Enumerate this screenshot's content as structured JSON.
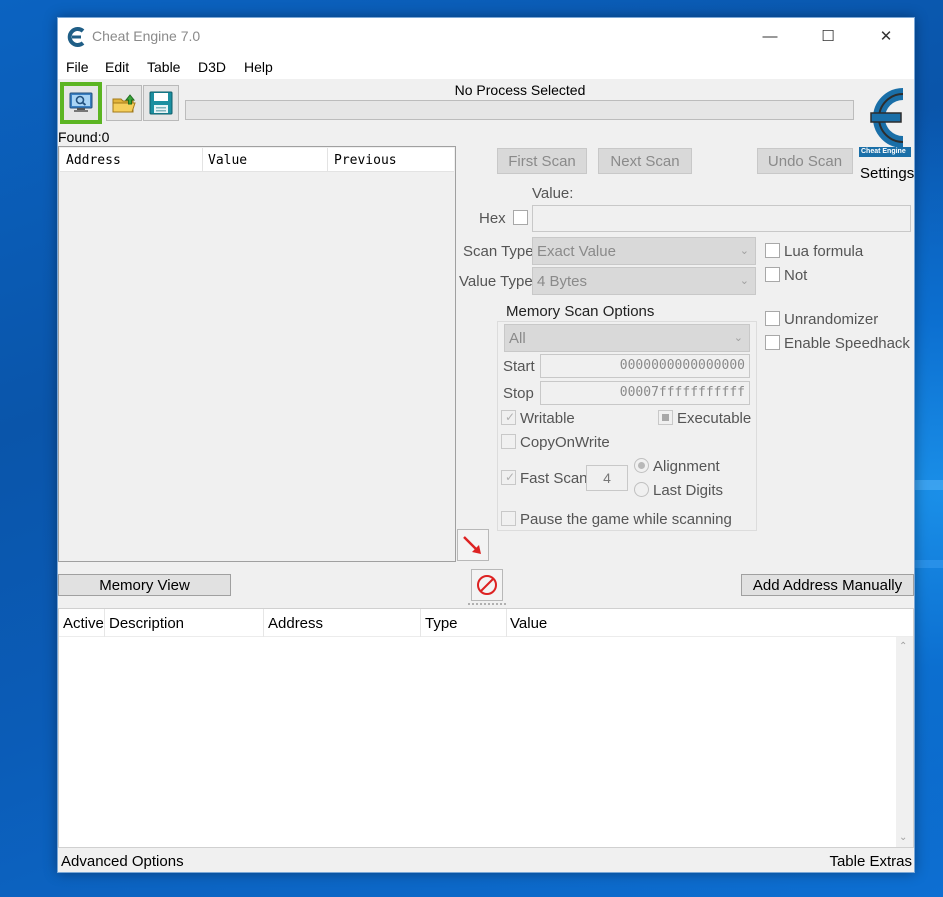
{
  "window": {
    "title": "Cheat Engine 7.0",
    "controls": {
      "minimize": "—",
      "maximize": "☐",
      "close": "✕"
    }
  },
  "menu": [
    "File",
    "Edit",
    "Table",
    "D3D",
    "Help"
  ],
  "toolbar": {
    "process_title": "No Process Selected",
    "icons": [
      "computer-search-icon",
      "open-folder-icon",
      "save-disk-icon"
    ]
  },
  "logo": {
    "text": "Cheat Engine"
  },
  "settings_label": "Settings",
  "found_label": "Found:0",
  "found_list": {
    "columns": [
      "Address",
      "Value",
      "Previous"
    ]
  },
  "scan": {
    "first_scan": "First Scan",
    "next_scan": "Next Scan",
    "undo_scan": "Undo Scan",
    "value_label": "Value:",
    "hex_label": "Hex",
    "scan_type_label": "Scan Type",
    "scan_type_value": "Exact Value",
    "value_type_label": "Value Type",
    "value_type_value": "4 Bytes",
    "lua_formula": "Lua formula",
    "not": "Not",
    "unrandomizer": "Unrandomizer",
    "enable_speedhack": "Enable Speedhack"
  },
  "memory_scan_options": {
    "title": "Memory Scan Options",
    "region": "All",
    "start_label": "Start",
    "start_value": "0000000000000000",
    "stop_label": "Stop",
    "stop_value": "00007fffffffffff",
    "writable": "Writable",
    "executable": "Executable",
    "copy_on_write": "CopyOnWrite",
    "fast_scan": "Fast Scan",
    "fast_scan_value": "4",
    "alignment": "Alignment",
    "last_digits": "Last Digits",
    "pause_game": "Pause the game while scanning"
  },
  "buttons": {
    "memory_view": "Memory View",
    "add_address": "Add Address Manually"
  },
  "address_table": {
    "columns": [
      "Active",
      "Description",
      "Address",
      "Type",
      "Value"
    ]
  },
  "bottom": {
    "advanced_options": "Advanced Options",
    "table_extras": "Table Extras"
  },
  "colors": {
    "highlight": "#5cb523",
    "accent_blue": "#1a6fa8",
    "desktop": "#0a5fb8"
  }
}
